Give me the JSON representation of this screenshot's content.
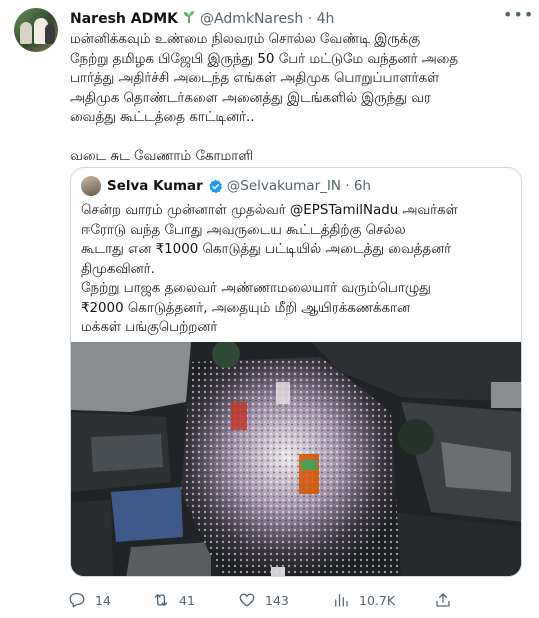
{
  "author": {
    "name": "Naresh ADMK",
    "badge_icon": "sprout-icon",
    "handle": "@AdmkNaresh",
    "time": "4h"
  },
  "tweet_text": "மன்னிக்கவும் உண்மை நிலவரம் சொல்ல வேண்டி இருக்கு\nநேற்று தமிழக பிஜேபி இருந்து 50 பேர் மட்டுமே வந்தனர் அதை\nபார்த்து அதிர்ச்சி அடைந்த எங்கள் அதிமுக பொறுப்பாளர்கள்\nஅதிமுக தொண்டர்களை அனைத்து இடங்களில் இருந்து வர\nவைத்து கூட்டத்தை காட்டினர்..\n\nவடை சுட வேணாம் கோமாளி",
  "quote": {
    "name": "Selva Kumar",
    "handle": "@Selvakumar_IN",
    "time": "6h",
    "text": "சென்ற வாரம் முன்னாள் முதல்வர் @EPSTamilNadu அவர்கள்\nஈரோடு வந்த போது அவருடைய கூட்டத்திற்கு செல்ல\nகூடாது என ₹1000 கொடுத்து பட்டியில் அடைத்து வைத்தனர்\nதிமுகவினர்.\nநேற்று பாஜக தலைவர் அண்ணாமலையார் வரும்பொழுது\n₹2000 கொடுத்தனர், அதையும் மீறி ஆயிரக்கணக்கான\nமக்கள் பங்குபெற்றனர்"
  },
  "actions": {
    "replies": "14",
    "retweets": "41",
    "likes": "143",
    "views": "10.7K"
  },
  "colors": {
    "text": "#0f1419",
    "muted": "#536471",
    "verified": "#1d9bf0",
    "border": "#cfd9de"
  }
}
